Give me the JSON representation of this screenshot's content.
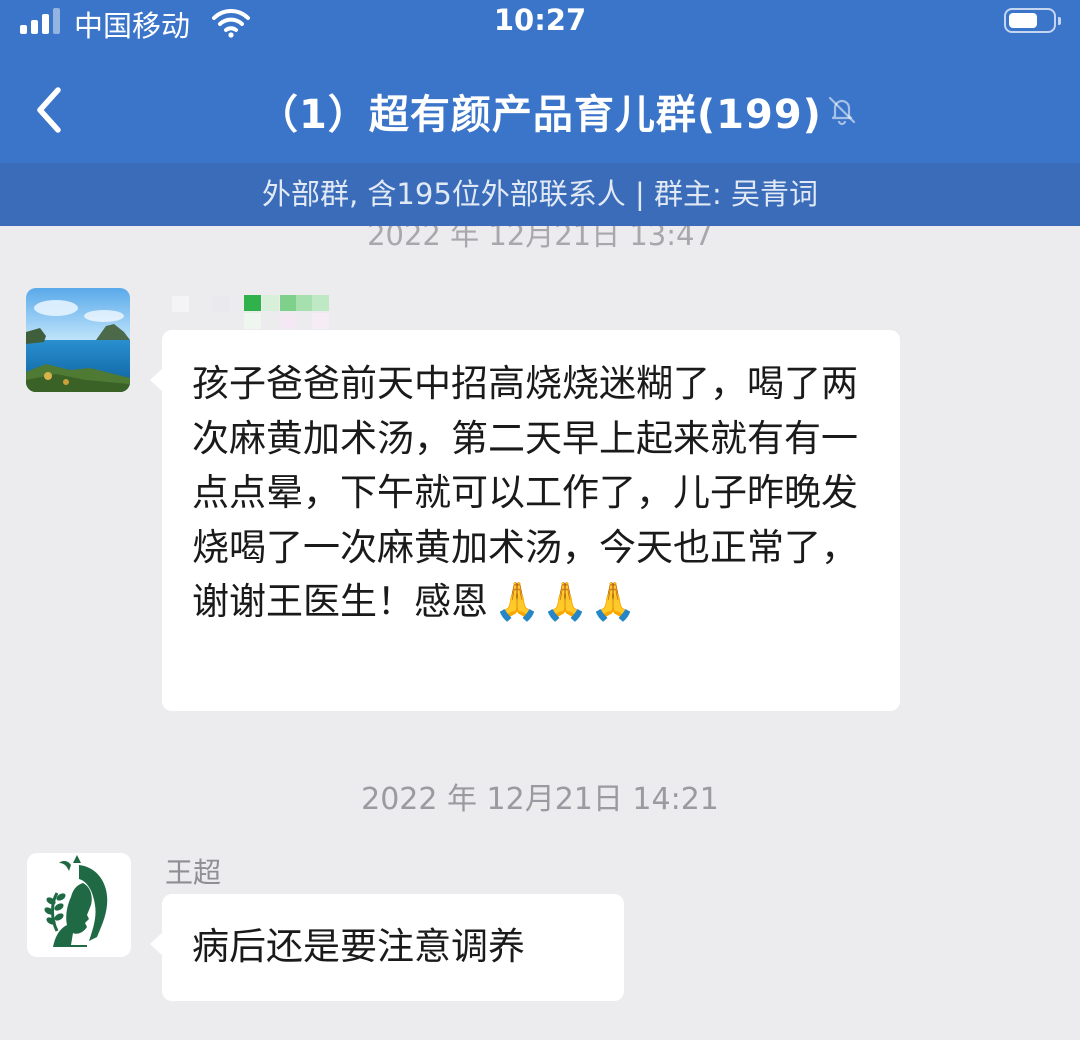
{
  "status": {
    "carrier": "中国移动",
    "time": "10:27"
  },
  "header": {
    "title": "（1）超有颜产品育儿群(199)",
    "info": "外部群, 含195位外部联系人 | 群主: 吴青词"
  },
  "messages": {
    "top_timestamp": "2022 年 12月21日 13:47",
    "msg1": {
      "text": "孩子爸爸前天中招高烧烧迷糊了，喝了两次麻黄加术汤，第二天早上起来就有有一点点晕，下午就可以工作了，儿子昨晚发烧喝了一次麻黄加术汤，今天也正常了，谢谢王医生！感恩",
      "emoji": "🙏🙏🙏"
    },
    "timestamp2": "2022 年 12月21日 14:21",
    "msg2": {
      "sender": "王超",
      "text": "病后还是要注意调养"
    }
  },
  "colors": {
    "header_bg": "#3b75c9",
    "info_bar_bg": "#3a6cb9",
    "chat_bg": "#ececef",
    "bubble_bg": "#ffffff",
    "logo_green": "#1f6a45"
  }
}
